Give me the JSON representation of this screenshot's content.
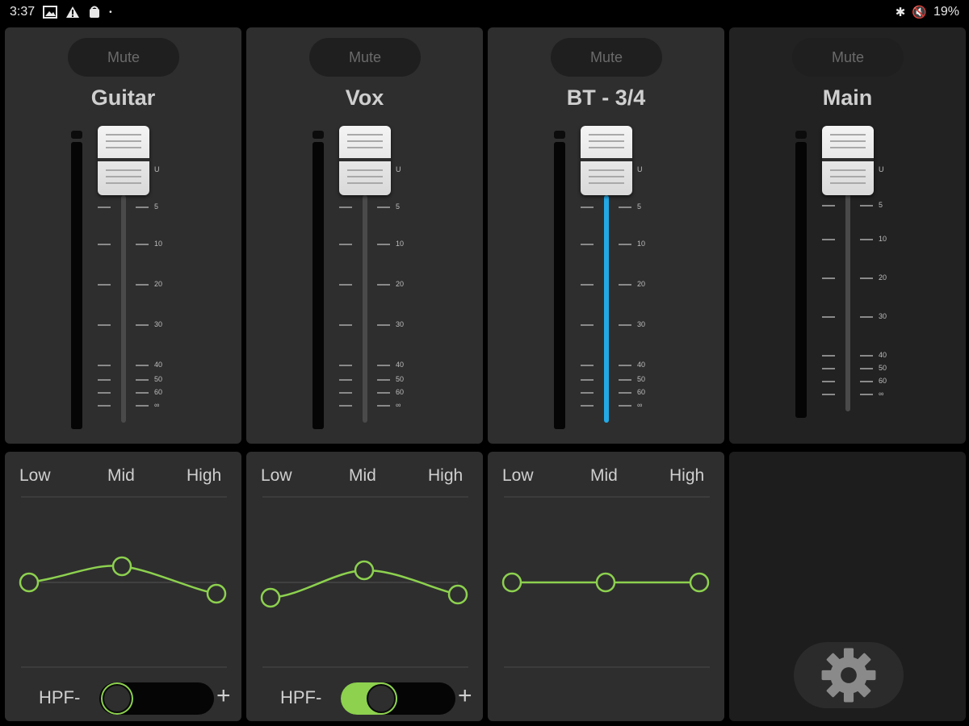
{
  "status_bar": {
    "time": "3:37",
    "left_icons": [
      "image-icon",
      "warning-icon",
      "bag-icon",
      "dot-icon"
    ],
    "right_icons": [
      "bluetooth-icon",
      "mute-vibrate-icon"
    ],
    "battery": "19%"
  },
  "colors": {
    "panel": "#2e2e2e",
    "accent_blue": "#22a9e6",
    "accent_green": "#8dd14f",
    "mute_text": "#6a6a6a"
  },
  "channels": [
    {
      "name": "Guitar",
      "mute_label": "Mute",
      "level_fill": 0,
      "hpf_on": false
    },
    {
      "name": "Vox",
      "mute_label": "Mute",
      "level_fill": 0,
      "hpf_on": true
    },
    {
      "name": "BT - 3/4",
      "mute_label": "Mute",
      "level_fill": 1,
      "hpf_on": null
    }
  ],
  "main": {
    "name": "Main",
    "mute_label": "Mute"
  },
  "fader_scale": [
    "U",
    "5",
    "10",
    "20",
    "30",
    "40",
    "50",
    "60",
    "∞"
  ],
  "eq": {
    "labels": {
      "low": "Low",
      "mid": "Mid",
      "high": "High"
    },
    "hpf_label": "HPF-",
    "hpf_plus": "+"
  },
  "settings": {
    "icon": "gear-icon"
  }
}
